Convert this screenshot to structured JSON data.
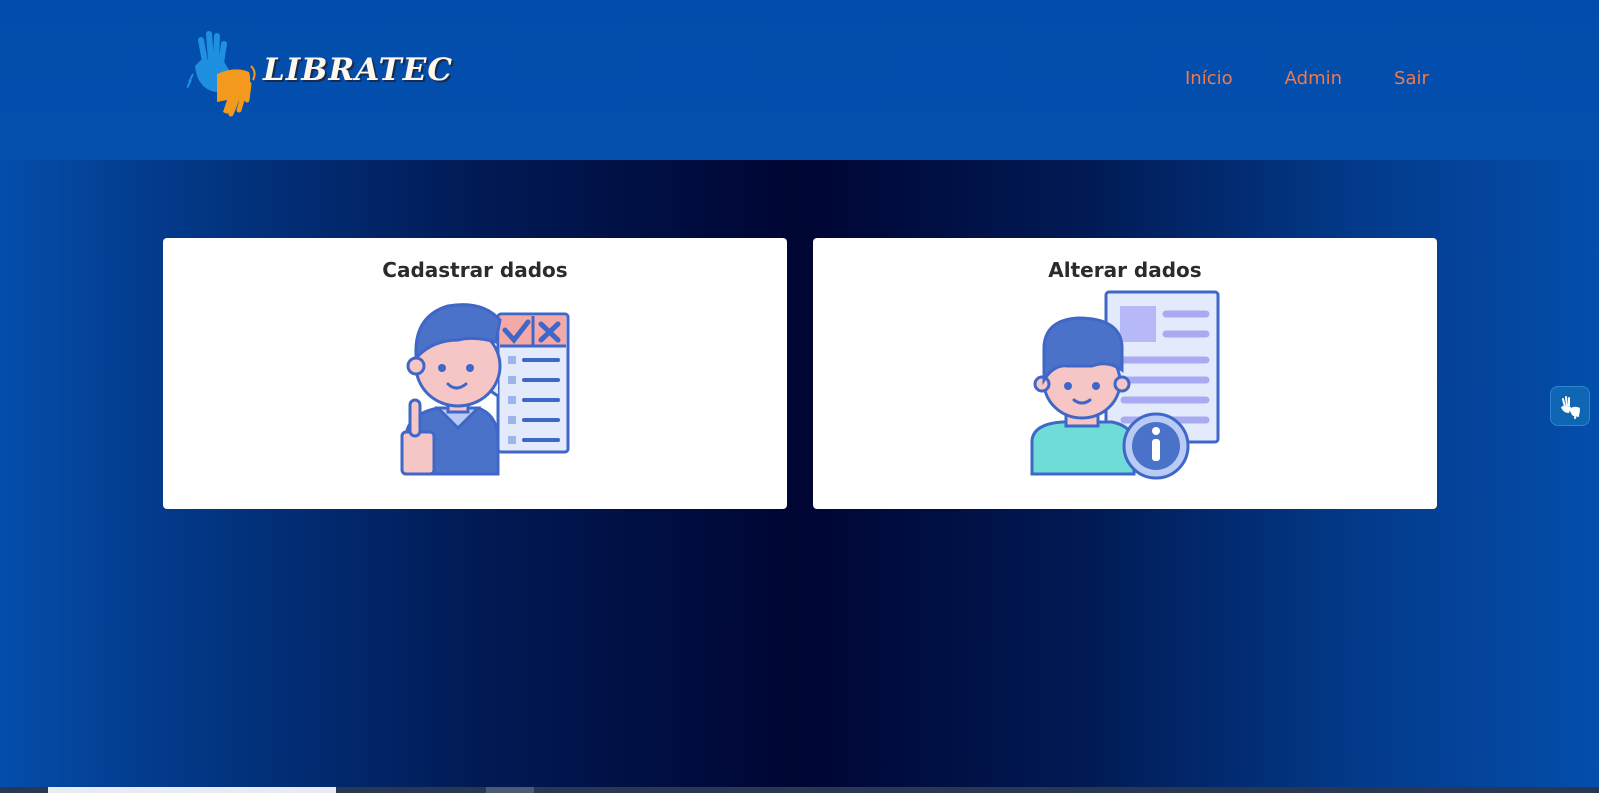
{
  "brand": {
    "name": "LIBRATEC"
  },
  "nav": {
    "items": [
      "Início",
      "Admin",
      "Sair"
    ]
  },
  "cards": [
    {
      "title": "Cadastrar dados"
    },
    {
      "title": "Alterar dados"
    }
  ],
  "colors": {
    "header_bg": "#044fac",
    "nav_link": "#f07a4a",
    "card_bg": "#ffffff",
    "accent_blue": "#4a72c8"
  },
  "icons": {
    "logo": "hands-logo-icon",
    "card1": "user-checklist-icon",
    "card2": "user-info-document-icon",
    "accessibility": "sign-language-hands-icon"
  }
}
